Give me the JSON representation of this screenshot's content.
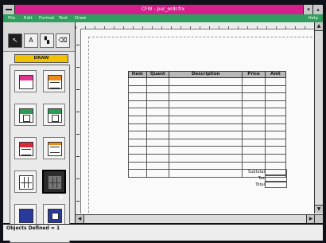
{
  "window": {
    "title": "CFW - pur_ordr.frx",
    "minimize_glyph": "▾",
    "maximize_glyph": "▴"
  },
  "menubar": {
    "items": [
      "File",
      "Edit",
      "Format",
      "Text",
      "Draw"
    ],
    "right_item": "Help"
  },
  "toolbar": {
    "select_glyph": "↖",
    "text_glyph": "A",
    "color_glyph": "▚",
    "erase_glyph": "⌫"
  },
  "palette": {
    "header": "DRAW",
    "items": [
      {
        "icon": "titled-box-icon",
        "accent": "#e0338f"
      },
      {
        "icon": "lined-box-icon",
        "accent": "#ef8a1a"
      },
      {
        "icon": "check-box-icon",
        "accent": "#2e9a55"
      },
      {
        "icon": "check-box-icon",
        "accent": "#2e9a55"
      },
      {
        "icon": "header-lines-icon",
        "accent": "#d62b3a"
      },
      {
        "icon": "lines-icon",
        "accent": "#ef8a1a"
      },
      {
        "icon": "grid-icon",
        "accent": "#555555"
      },
      {
        "icon": "grid-selected-icon",
        "accent": "#222222"
      },
      {
        "icon": "button-icon",
        "accent": "#2a3a9a"
      },
      {
        "icon": "button-icon",
        "accent": "#2a3a9a"
      }
    ]
  },
  "form": {
    "columns": [
      "Item",
      "Quant",
      "Description",
      "Price",
      "Amt"
    ],
    "row_count": 13,
    "totals": [
      "Subtotal",
      "Tax",
      "Total"
    ]
  },
  "status": {
    "text": "Objects Defined = 1"
  },
  "colors": {
    "titlebar": "#d61f8c",
    "menubar": "#2f9e5e",
    "draw_header": "#f2c200"
  }
}
